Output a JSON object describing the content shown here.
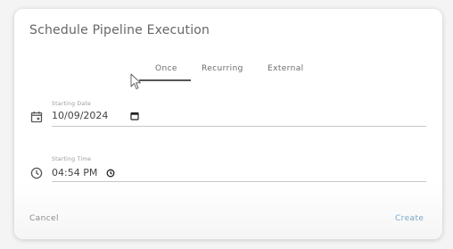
{
  "dialog": {
    "title": "Schedule Pipeline Execution"
  },
  "tabs": [
    {
      "label": "Once",
      "selected": true
    },
    {
      "label": "Recurring",
      "selected": false
    },
    {
      "label": "External",
      "selected": false
    }
  ],
  "fields": {
    "date": {
      "label": "Starting Date",
      "value": "10/09/2024",
      "icon": "calendar-icon",
      "picker_icon": "calendar-picker-icon"
    },
    "time": {
      "label": "Starting Time",
      "value": "04:54 PM",
      "icon": "clock-icon",
      "picker_icon": "clock-picker-icon"
    }
  },
  "footer": {
    "cancel_label": "Cancel",
    "create_label": "Create"
  },
  "colors": {
    "accent": "#7aa6c8",
    "tab_indicator": "#555555"
  }
}
